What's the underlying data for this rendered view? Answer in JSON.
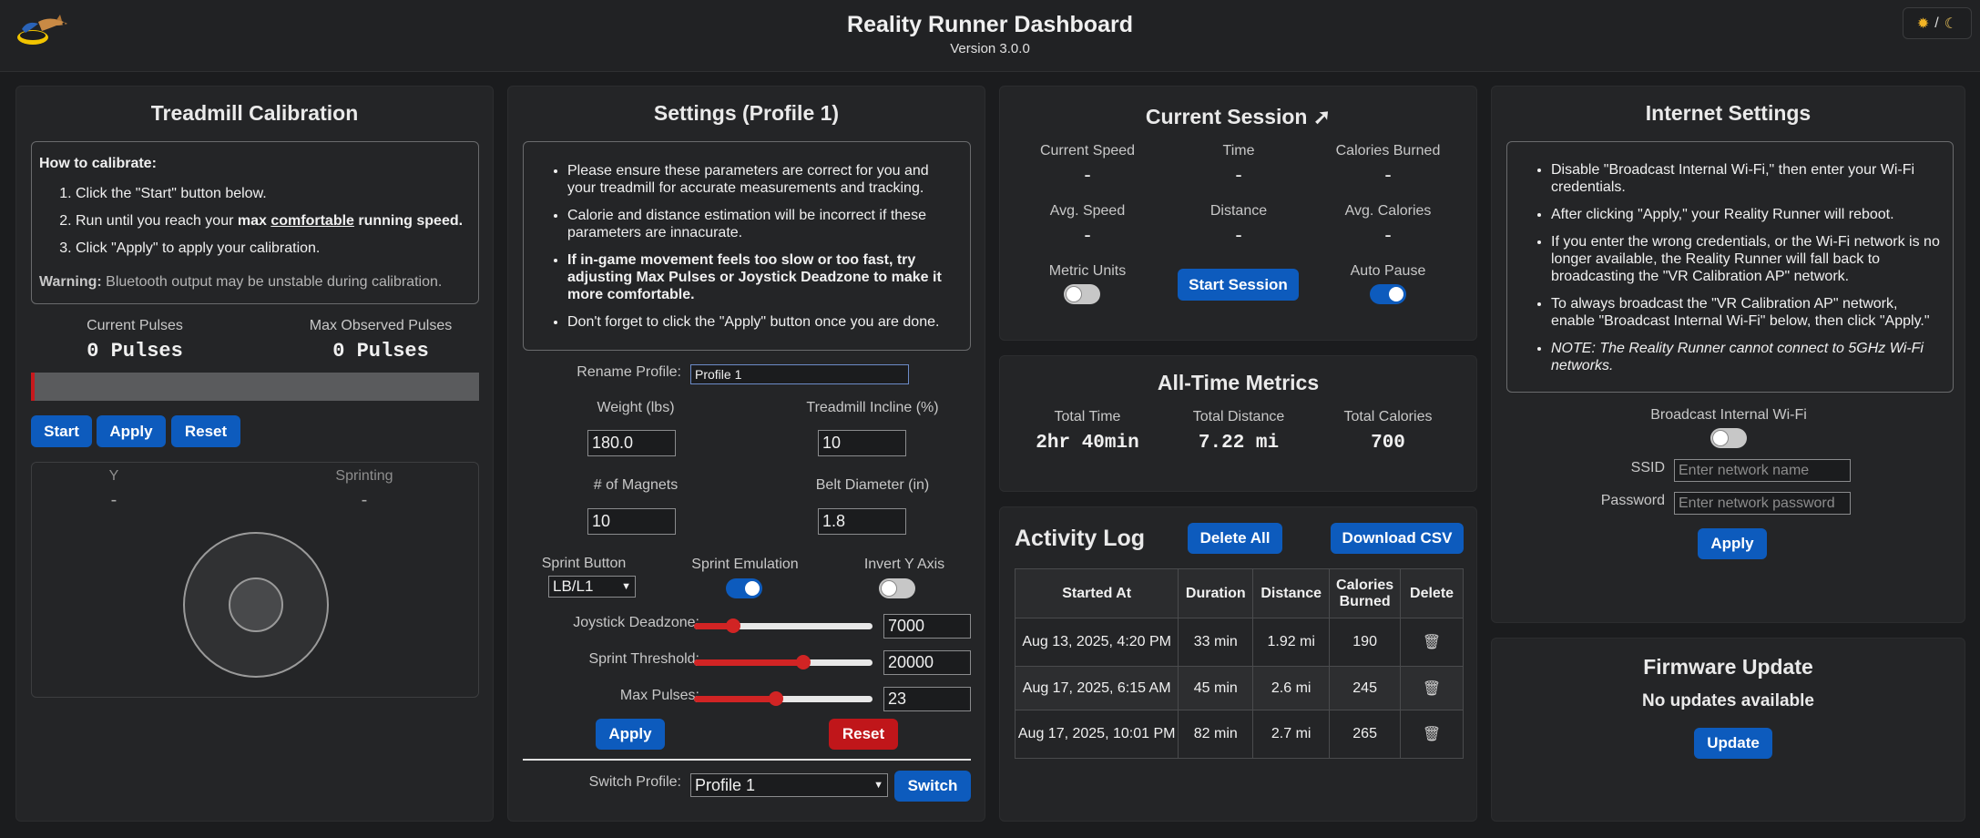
{
  "header": {
    "title": "Reality Runner Dashboard",
    "version": "Version 3.0.0",
    "theme_separator": "/"
  },
  "calibration": {
    "title": "Treadmill Calibration",
    "howto_title": "How to calibrate:",
    "step1": "Click the \"Start\" button below.",
    "step2_pre": "Run until you reach your ",
    "step2_max": "max",
    "step2_comfortable": "comfortable",
    "step2_post": " running speed.",
    "step3": "Click \"Apply\" to apply your calibration.",
    "warning_label": "Warning:",
    "warning_text": " Bluetooth output may be unstable during calibration.",
    "current_pulses_label": "Current Pulses",
    "current_pulses_value": "0 Pulses",
    "max_pulses_label": "Max Observed Pulses",
    "max_pulses_value": "0 Pulses",
    "progress_fraction": 0.0,
    "start_label": "Start",
    "apply_label": "Apply",
    "reset_label": "Reset",
    "y_label": "Y",
    "y_value": "-",
    "sprinting_label": "Sprinting",
    "sprinting_value": "-"
  },
  "settings": {
    "title": "Settings (Profile 1)",
    "notes": [
      "Please ensure these parameters are correct for you and your treadmill for accurate measurements and tracking.",
      "Calorie and distance estimation will be incorrect if these parameters are innacurate.",
      "If in-game movement feels too slow or too fast, try adjusting Max Pulses or Joystick Deadzone to make it more comfortable.",
      "Don't forget to click the \"Apply\" button once you are done."
    ],
    "rename_label": "Rename Profile:",
    "rename_value": "Profile 1",
    "weight_label": "Weight (lbs)",
    "weight_value": "180.0",
    "incline_label": "Treadmill Incline (%)",
    "incline_value": "10",
    "magnets_label": "# of Magnets",
    "magnets_value": "10",
    "belt_label": "Belt Diameter (in)",
    "belt_value": "1.8",
    "sprint_button_label": "Sprint Button",
    "sprint_button_value": "LB/L1",
    "sprint_emulation_label": "Sprint Emulation",
    "sprint_emulation_on": true,
    "invert_y_label": "Invert Y Axis",
    "invert_y_on": false,
    "deadzone_label": "Joystick Deadzone:",
    "deadzone_value": "7000",
    "deadzone_fraction": 0.22,
    "threshold_label": "Sprint Threshold:",
    "threshold_value": "20000",
    "threshold_fraction": 0.61,
    "maxpulses_label": "Max Pulses:",
    "maxpulses_value": "23",
    "maxpulses_fraction": 0.46,
    "apply_label": "Apply",
    "reset_label": "Reset",
    "switch_label": "Switch Profile:",
    "switch_value": "Profile 1",
    "switch_button": "Switch"
  },
  "session": {
    "title": "Current Session",
    "current_speed_label": "Current Speed",
    "current_speed_value": "-",
    "time_label": "Time",
    "time_value": "-",
    "calories_label": "Calories Burned",
    "calories_value": "-",
    "avg_speed_label": "Avg. Speed",
    "avg_speed_value": "-",
    "distance_label": "Distance",
    "distance_value": "-",
    "avg_calories_label": "Avg. Calories",
    "avg_calories_value": "-",
    "metric_label": "Metric Units",
    "metric_on": false,
    "start_label": "Start Session",
    "autopause_label": "Auto Pause",
    "autopause_on": true
  },
  "alltime": {
    "title": "All-Time Metrics",
    "total_time_label": "Total Time",
    "total_time_value": "2hr 40min",
    "total_distance_label": "Total Distance",
    "total_distance_value": "7.22 mi",
    "total_calories_label": "Total Calories",
    "total_calories_value": "700"
  },
  "log": {
    "title": "Activity Log",
    "delete_all": "Delete All",
    "download_csv": "Download CSV",
    "headers": [
      "Started At",
      "Duration",
      "Distance",
      "Calories Burned",
      "Delete"
    ],
    "rows": [
      {
        "started": "Aug 13, 2025, 4:20 PM",
        "duration": "33 min",
        "distance": "1.92 mi",
        "calories": "190"
      },
      {
        "started": "Aug 17, 2025, 6:15 AM",
        "duration": "45 min",
        "distance": "2.6 mi",
        "calories": "245"
      },
      {
        "started": "Aug 17, 2025, 10:01 PM",
        "duration": "82 min",
        "distance": "2.7 mi",
        "calories": "265"
      }
    ]
  },
  "internet": {
    "title": "Internet Settings",
    "notes": [
      "Disable \"Broadcast Internal Wi-Fi,\" then enter your Wi-Fi credentials.",
      "After clicking \"Apply,\" your Reality Runner will reboot.",
      "If you enter the wrong credentials, or the Wi-Fi network is no longer available, the Reality Runner will fall back to broadcasting the \"VR Calibration AP\" network.",
      "To always broadcast the \"VR Calibration AP\" network, enable \"Broadcast Internal Wi-Fi\" below, then click \"Apply.\"",
      "NOTE: The Reality Runner cannot connect to 5GHz Wi-Fi networks."
    ],
    "broadcast_label": "Broadcast Internal Wi-Fi",
    "broadcast_on": false,
    "ssid_label": "SSID",
    "ssid_placeholder": "Enter network name",
    "password_label": "Password",
    "password_placeholder": "Enter network password",
    "apply_label": "Apply"
  },
  "firmware": {
    "title": "Firmware Update",
    "status": "No updates available",
    "update_label": "Update"
  },
  "colors": {
    "accent": "#0d5bbd",
    "danger": "#c0161a",
    "slider": "#d12424"
  }
}
